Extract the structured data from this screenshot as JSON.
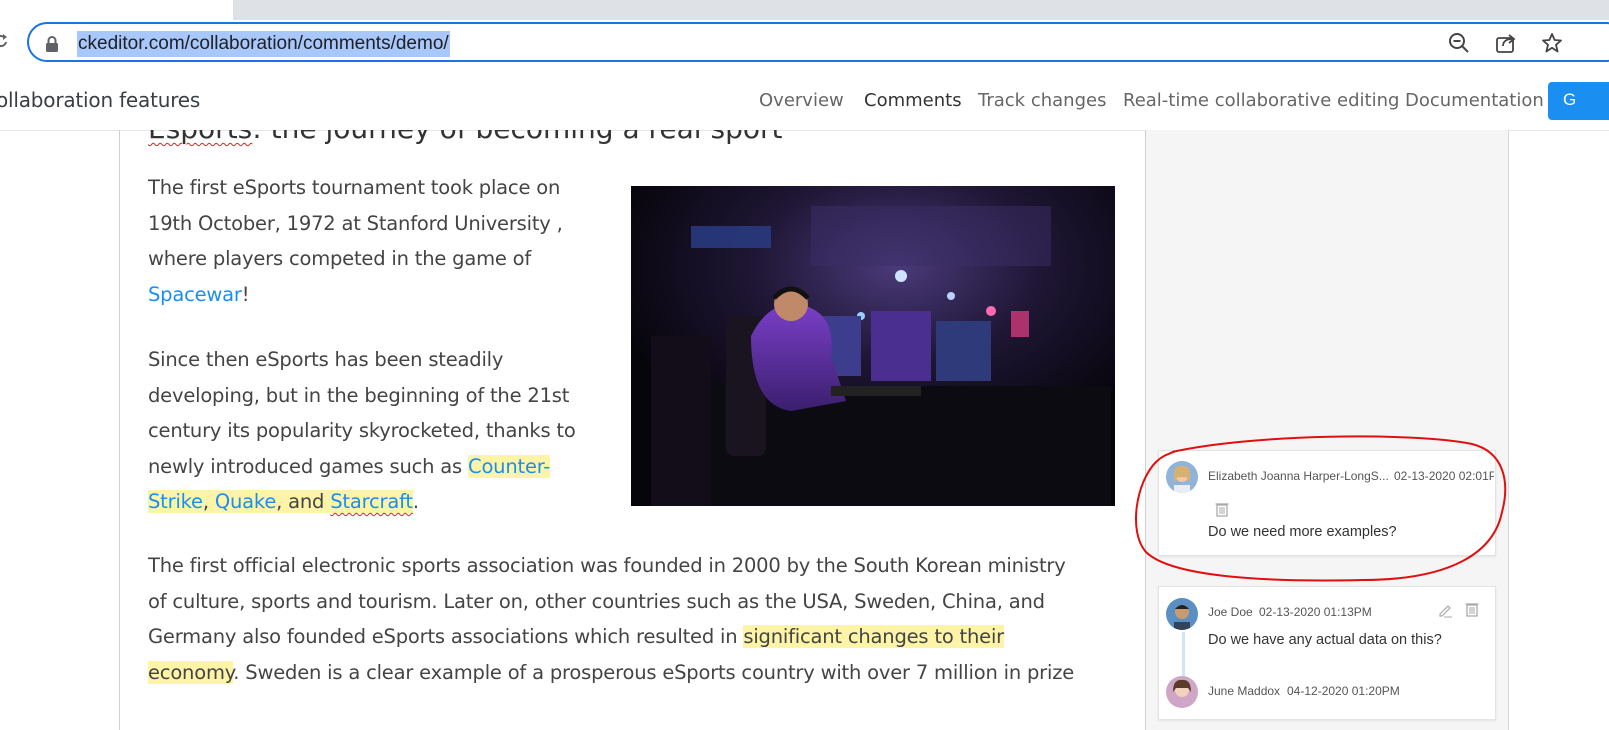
{
  "browser": {
    "url": "ckeditor.com/collaboration/comments/demo/"
  },
  "site": {
    "brand": "ollaboration features",
    "nav": [
      "Overview",
      "Comments",
      "Track changes",
      "Real-time collaborative editing",
      "Documentation"
    ],
    "active_nav": "Comments",
    "cta_label": "G"
  },
  "doc": {
    "heading_part1": "Esports",
    "heading_part2": ": the journey of becoming a real sport",
    "p1_l1": "The first eSports tournament took place on",
    "p1_l2": "19th October, 1972 at Stanford University ,",
    "p1_l3": "where players competed in the game of",
    "p1_link": "Spacewar",
    "p1_end": "!",
    "p2_l1": "Since then eSports has been steadily",
    "p2_l2": "developing, but in the beginning of the 21st",
    "p2_l3": "century its popularity skyrocketed, thanks to",
    "p2_l4": "newly introduced games such as ",
    "p2_link1a": "Counter-",
    "p2_link1b": "Strike",
    "p2_comma": ", ",
    "p2_link2": "Quake",
    "p2_and": ", and ",
    "p2_link3": "Starcraft",
    "p2_period": ".",
    "p3_l1": "The first official electronic sports association was founded in 2000 by the South Korean ministry",
    "p3_l2": "of culture, sports and tourism. Later on, other countries such as the USA, Sweden, China, and",
    "p3_l3a": "Germany also founded eSports associations which resulted in ",
    "p3_l3hl": "significant changes to their",
    "p3_l4hl": "economy",
    "p3_l4b": ". Sweden is a clear example of a prosperous eSports country with over 7 million in prize"
  },
  "comments": [
    {
      "author": "Elizabeth Joanna Harper-LongS...",
      "date": "02-13-2020 02:01P",
      "text": "Do we need more examples?"
    },
    {
      "author": "Joe Doe",
      "date": "02-13-2020 01:13PM",
      "text": "Do we have any actual data on this?"
    },
    {
      "author": "June Maddox",
      "date": "04-12-2020 01:20PM"
    }
  ],
  "colors": {
    "link": "#1b8ef2",
    "highlight": "#fdf4a8",
    "annotation": "#e01010",
    "omnibox_border": "#1a73e8"
  }
}
